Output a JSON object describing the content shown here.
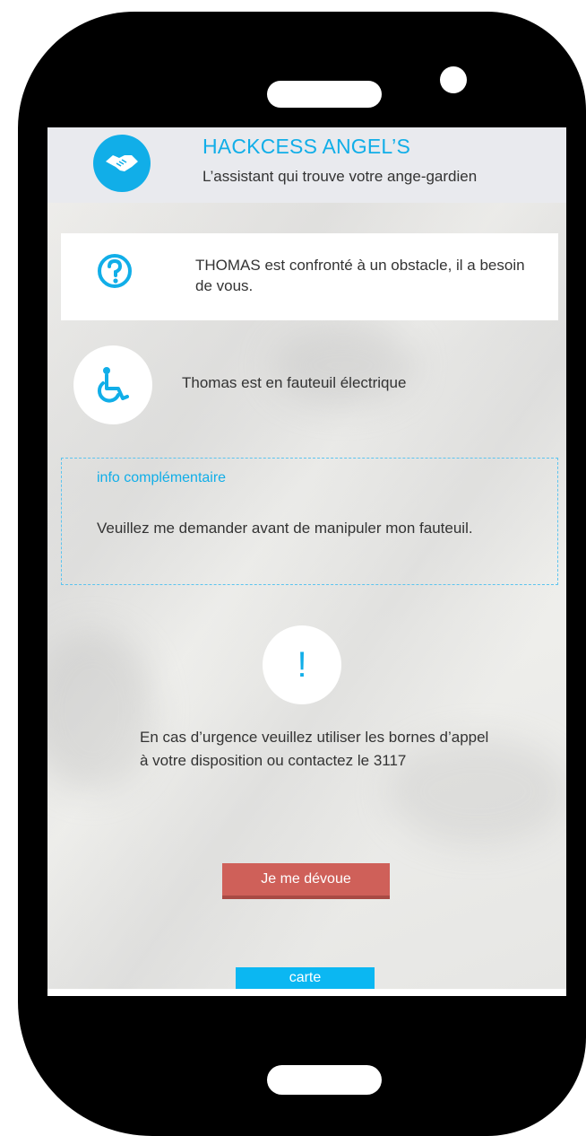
{
  "header": {
    "title": "HACKCESS ANGEL’S",
    "subtitle": "L’assistant qui trouve votre ange-gardien"
  },
  "alert": {
    "text": "THOMAS est confronté à un obstacle, il a besoin de vous."
  },
  "mobility": {
    "text": "Thomas est en fauteuil électrique"
  },
  "info": {
    "label": "info complémentaire",
    "text": "Veuillez me demander avant de manipuler mon fauteuil."
  },
  "urgency": {
    "icon_glyph": "!",
    "text": "En cas d’urgence veuillez utiliser les bornes d’appel à votre disposition ou contactez le 3117"
  },
  "actions": {
    "devoue_label": "Je me dévoue",
    "carte_label": "carte"
  },
  "colors": {
    "accent": "#11aee8",
    "button_red": "#cf6059",
    "header_bg": "#e9eaee"
  },
  "icons": [
    "handshake-icon",
    "question-icon",
    "wheelchair-icon",
    "exclamation-icon"
  ]
}
